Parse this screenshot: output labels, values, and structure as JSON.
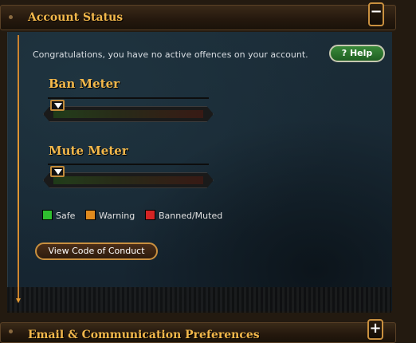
{
  "account_status": {
    "title": "Account Status",
    "collapse_symbol": "−",
    "message": "Congratulations, you have no active offences on your account.",
    "help_label": "? Help",
    "ban_meter": {
      "label": "Ban Meter",
      "level": 0
    },
    "mute_meter": {
      "label": "Mute Meter",
      "level": 0
    },
    "legend": [
      {
        "label": "Safe",
        "color": "#2fbf2f"
      },
      {
        "label": "Warning",
        "color": "#e08a1e"
      },
      {
        "label": "Banned/Muted",
        "color": "#d42424"
      }
    ],
    "conduct_button": "View Code of Conduct"
  },
  "email_section": {
    "title": "Email & Communication Preferences",
    "expand_symbol": "+"
  },
  "colors": {
    "accent": "#f3b84b",
    "border": "#c9903f",
    "help_green": "#2f7a2f"
  }
}
